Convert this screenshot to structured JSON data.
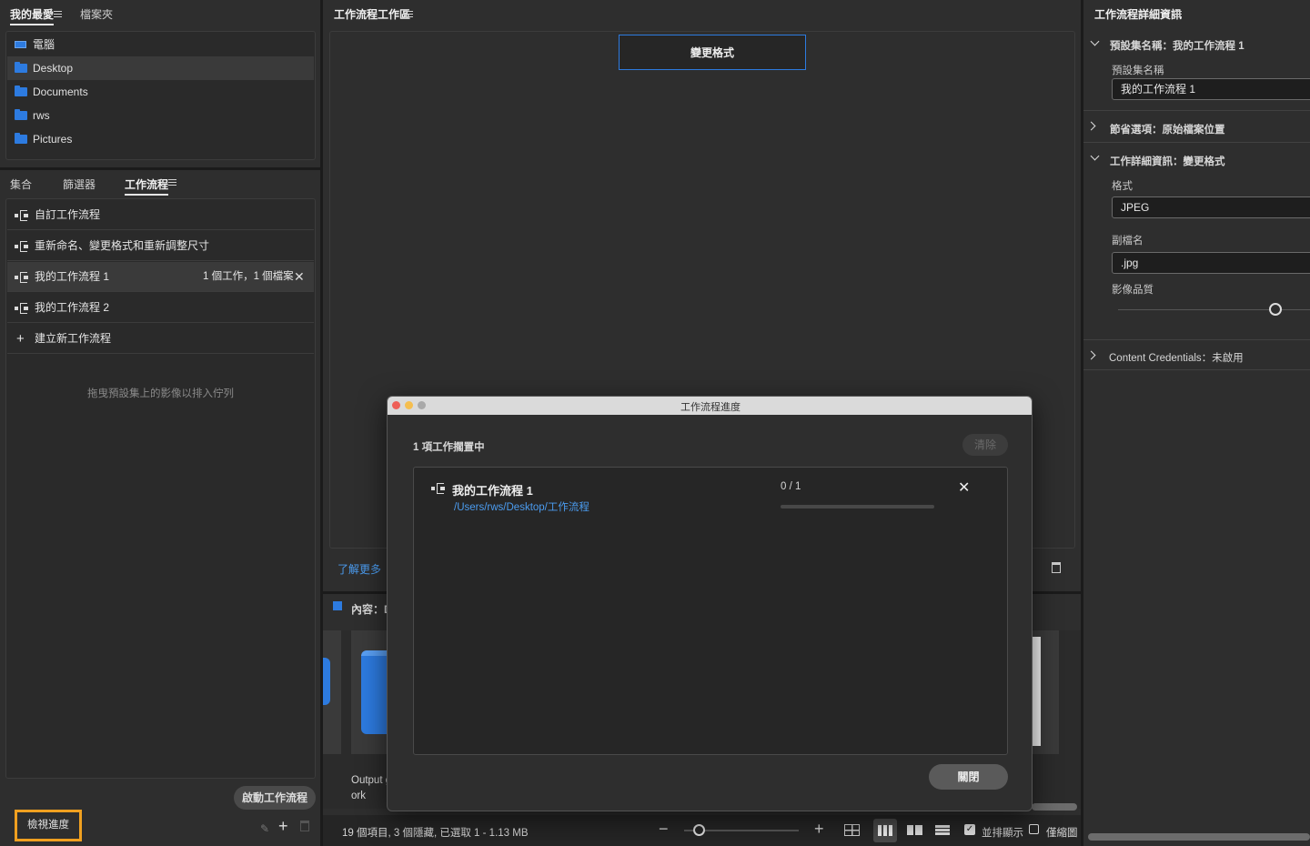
{
  "left_top": {
    "tabs": [
      {
        "label": "我的最愛"
      },
      {
        "label": "檔案夾"
      }
    ],
    "items": [
      {
        "label": "電腦",
        "icon": "computer-icon"
      },
      {
        "label": "Desktop",
        "icon": "folder-icon"
      },
      {
        "label": "Documents",
        "icon": "folder-icon"
      },
      {
        "label": "rws",
        "icon": "folder-icon"
      },
      {
        "label": "Pictures",
        "icon": "folder-icon"
      }
    ]
  },
  "left_bottom": {
    "tabs": [
      {
        "label": "集合"
      },
      {
        "label": "篩選器"
      },
      {
        "label": "工作流程"
      }
    ],
    "workflows": [
      {
        "label": "自訂工作流程"
      },
      {
        "label": "重新命名、變更格式和重新調整尺寸"
      },
      {
        "label": "我的工作流程 1",
        "status": "1 個工作，1 個檔案"
      },
      {
        "label": "我的工作流程 2"
      }
    ],
    "new_workflow": "建立新工作流程",
    "queue_hint": "拖曳預設集上的影像以排入佇列",
    "start_button": "啟動工作流程",
    "view_progress": "檢視進度"
  },
  "center": {
    "title": "工作流程工作區",
    "step_card": "變更格式",
    "learn_more": "了解更多",
    "content_label": "內容：De",
    "thumb_caption_1": "Output g",
    "thumb_caption_2": "ork",
    "status_text": "19 個項目, 3 個隱藏, 已選取 1 - 1.13 MB",
    "stack_label": "並排顯示",
    "thumb_only_label": "僅縮圖"
  },
  "right": {
    "title": "工作流程詳細資訊",
    "preset_section": "預設集名稱：我的工作流程 1",
    "preset_name_label": "預設集名稱",
    "preset_name_value": "我的工作流程 1",
    "save_section": "節省選項：原始檔案位置",
    "job_section": "工作詳細資訊：變更格式",
    "format_label": "格式",
    "format_value": "JPEG",
    "ext_label": "副檔名",
    "ext_value": ".jpg",
    "quality_label": "影像品質",
    "quality_level": 0.82,
    "cc_section": "Content Credentials：未啟用"
  },
  "dialog": {
    "title": "工作流程進度",
    "summary": "1 項工作擱置中",
    "clear_button": "清除",
    "job": {
      "name": "我的工作流程 1",
      "path": "/Users/rws/Desktop/工作流程",
      "progress_text": "0 / 1",
      "progress": 0
    },
    "close_button": "關閉"
  },
  "colors": {
    "accent_blue": "#2d7be0",
    "highlight_orange": "#f0a020",
    "link_blue": "#4b9cf0"
  }
}
